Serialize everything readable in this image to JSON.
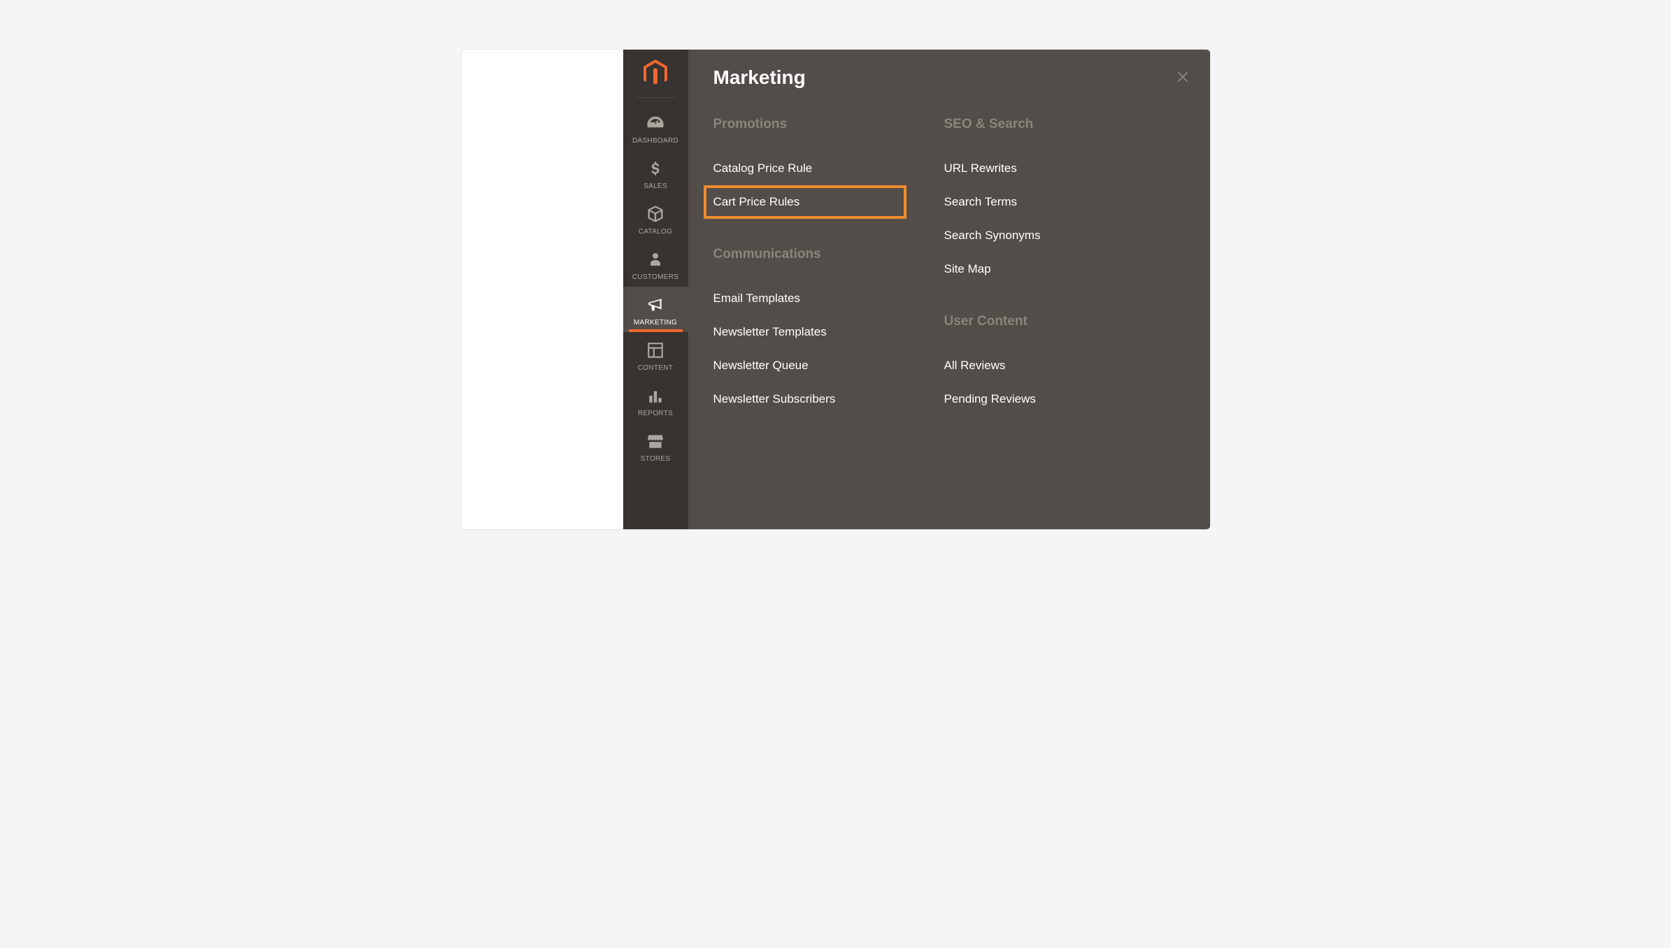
{
  "sidebar": {
    "items": [
      {
        "label": "DASHBOARD",
        "icon": "gauge"
      },
      {
        "label": "SALES",
        "icon": "dollar"
      },
      {
        "label": "CATALOG",
        "icon": "box"
      },
      {
        "label": "CUSTOMERS",
        "icon": "person"
      },
      {
        "label": "MARKETING",
        "icon": "megaphone"
      },
      {
        "label": "CONTENT",
        "icon": "layout"
      },
      {
        "label": "REPORTS",
        "icon": "bars"
      },
      {
        "label": "STORES",
        "icon": "storefront"
      }
    ]
  },
  "flyout": {
    "title": "Marketing",
    "columns": [
      {
        "sections": [
          {
            "title": "Promotions",
            "items": [
              {
                "label": "Catalog Price Rule",
                "highlighted": false
              },
              {
                "label": "Cart Price Rules",
                "highlighted": true
              }
            ]
          },
          {
            "title": "Communications",
            "items": [
              {
                "label": "Email Templates"
              },
              {
                "label": "Newsletter Templates"
              },
              {
                "label": "Newsletter Queue"
              },
              {
                "label": "Newsletter Subscribers"
              }
            ]
          }
        ]
      },
      {
        "sections": [
          {
            "title": "SEO & Search",
            "items": [
              {
                "label": "URL Rewrites"
              },
              {
                "label": "Search Terms"
              },
              {
                "label": "Search Synonyms"
              },
              {
                "label": "Site Map"
              }
            ]
          },
          {
            "title": "User Content",
            "items": [
              {
                "label": "All Reviews"
              },
              {
                "label": "Pending Reviews"
              }
            ]
          }
        ]
      }
    ]
  }
}
